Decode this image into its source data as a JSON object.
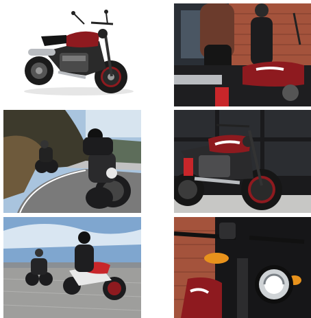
{
  "gallery": {
    "images": [
      {
        "name": "studio-side-view-photo",
        "description_icon": "motorcycle-icon"
      },
      {
        "name": "rider-seated-closeup-photo",
        "description_icon": "motorcycle-icon"
      },
      {
        "name": "mountain-road-cornering-photo",
        "description_icon": "motorcycle-icon"
      },
      {
        "name": "urban-parked-side-photo",
        "description_icon": "motorcycle-icon"
      },
      {
        "name": "two-riders-track-photo",
        "description_icon": "motorcycle-icon"
      },
      {
        "name": "headlight-front-closeup-photo",
        "description_icon": "motorcycle-icon"
      }
    ],
    "colors": {
      "tank_red": "#8e1a1f",
      "frame_dark": "#1c1c1e",
      "chrome": "#b9bcc0",
      "sky": "#a9c4de",
      "brick": "#a4533c"
    }
  }
}
